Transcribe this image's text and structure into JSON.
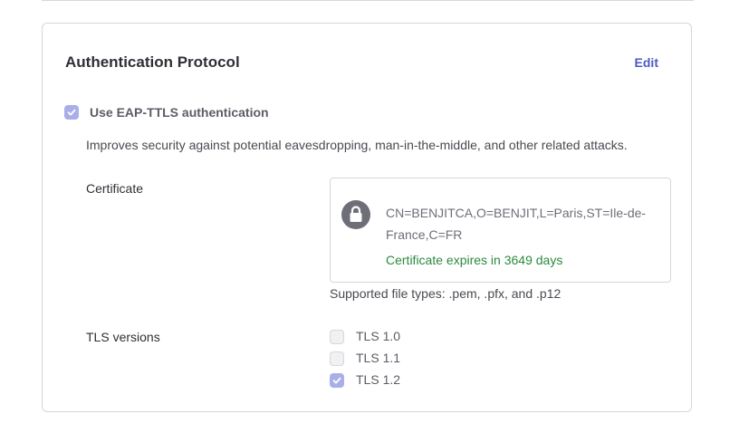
{
  "section": {
    "title": "Authentication Protocol",
    "edit_label": "Edit"
  },
  "eap": {
    "label": "Use EAP-TTLS authentication",
    "checked": true,
    "description": "Improves security against potential eavesdropping, man-in-the-middle, and other related attacks."
  },
  "certificate": {
    "label": "Certificate",
    "icon": "lock-icon",
    "name": "CN=BENJITCA,O=BENJIT,L=Paris,ST=Ile-de-France,C=FR",
    "expiry": "Certificate expires in 3649 days",
    "supported_types": "Supported file types: .pem, .pfx, and .p12"
  },
  "tls": {
    "label": "TLS versions",
    "versions": [
      {
        "label": "TLS 1.0",
        "checked": false
      },
      {
        "label": "TLS 1.1",
        "checked": false
      },
      {
        "label": "TLS 1.2",
        "checked": true
      }
    ]
  },
  "colors": {
    "accent": "#4c5ac2",
    "checkbox_checked": "#a9aee8",
    "success": "#2b8a3e",
    "border": "#d7d7dc"
  }
}
